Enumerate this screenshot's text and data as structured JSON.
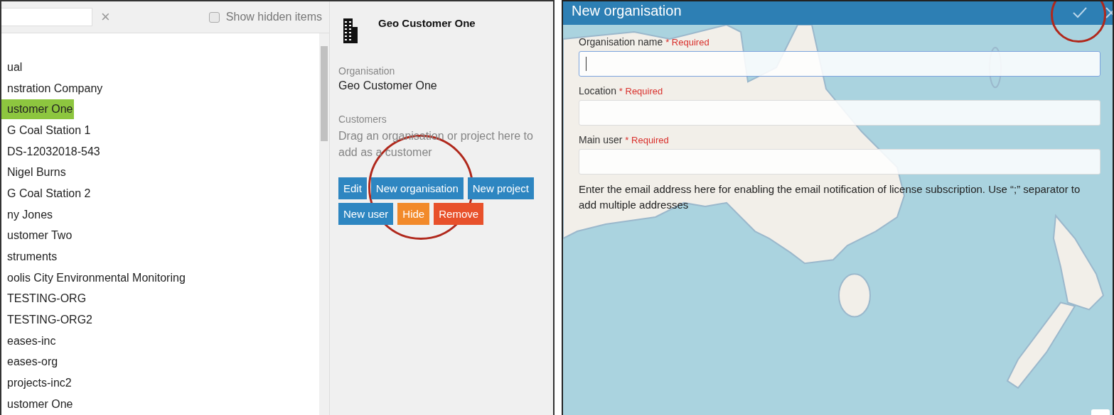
{
  "organisations_panel": {
    "search": {
      "clear": "×"
    },
    "show_hidden": {
      "label": "Show hidden items",
      "checked": false
    },
    "items": [
      {
        "name": "ual",
        "selected": false
      },
      {
        "name": "nstration Company",
        "selected": false
      },
      {
        "name": "ustomer One",
        "selected": true
      },
      {
        "name": "G Coal Station 1",
        "selected": false
      },
      {
        "name": "DS-12032018-543",
        "selected": false
      },
      {
        "name": "Nigel Burns",
        "selected": false
      },
      {
        "name": "G Coal Station 2",
        "selected": false
      },
      {
        "name": "ny Jones",
        "selected": false
      },
      {
        "name": "ustomer Two",
        "selected": false
      },
      {
        "name": "struments",
        "selected": false
      },
      {
        "name": "oolis City Environmental Monitoring",
        "selected": false
      },
      {
        "name": "TESTING-ORG",
        "selected": false
      },
      {
        "name": "TESTING-ORG2",
        "selected": false
      },
      {
        "name": "eases-inc",
        "selected": false
      },
      {
        "name": "eases-org",
        "selected": false
      },
      {
        "name": "projects-inc2",
        "selected": false
      },
      {
        "name": "ustomer One",
        "selected": false
      }
    ]
  },
  "details": {
    "title": "Geo Customer One",
    "type_label": "Organisation",
    "type_value": "Geo Customer One",
    "customers_label": "Customers",
    "customers_hint": "Drag an organisation or project here to add as a customer",
    "buttons": [
      {
        "label": "Edit",
        "kind": "primary"
      },
      {
        "label": "New organisation",
        "kind": "primary"
      },
      {
        "label": "New project",
        "kind": "primary"
      },
      {
        "label": "New user",
        "kind": "primary"
      },
      {
        "label": "Hide",
        "kind": "warning"
      },
      {
        "label": "Remove",
        "kind": "danger"
      }
    ]
  },
  "dialog": {
    "title": "New organisation",
    "fields": [
      {
        "label": "Organisation name",
        "required": "* Required",
        "focused": true
      },
      {
        "label": "Location",
        "required": "* Required",
        "focused": false
      },
      {
        "label": "Main user",
        "required": "* Required",
        "focused": false
      }
    ],
    "help": "Enter the email address here for enabling the email notification of license subscription. Use “;” separator to add multiple addresses"
  }
}
